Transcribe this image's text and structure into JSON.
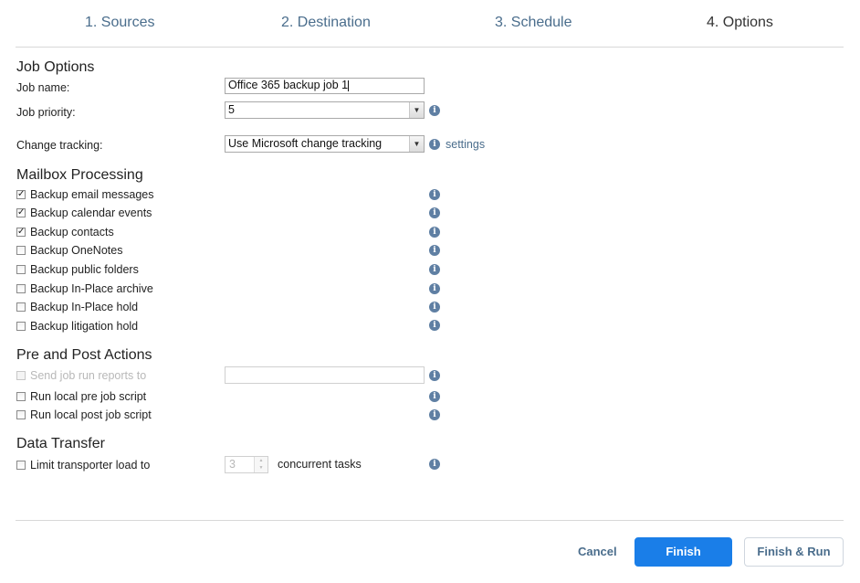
{
  "wizard": {
    "steps": [
      "1. Sources",
      "2. Destination",
      "3. Schedule",
      "4. Options"
    ],
    "active_step": 3
  },
  "job_options": {
    "title": "Job Options",
    "job_name_label": "Job name:",
    "job_name_value": "Office 365 backup job 1",
    "priority_label": "Job priority:",
    "priority_value": "5",
    "change_tracking_label": "Change tracking:",
    "change_tracking_value": "Use Microsoft change tracking",
    "settings_link": "settings"
  },
  "mailbox": {
    "title": "Mailbox Processing",
    "items": [
      {
        "label": "Backup email messages",
        "checked": true
      },
      {
        "label": "Backup calendar events",
        "checked": true
      },
      {
        "label": "Backup contacts",
        "checked": true
      },
      {
        "label": "Backup OneNotes",
        "checked": false
      },
      {
        "label": "Backup public folders",
        "checked": false
      },
      {
        "label": "Backup In-Place archive",
        "checked": false
      },
      {
        "label": "Backup In-Place hold",
        "checked": false
      },
      {
        "label": "Backup litigation hold",
        "checked": false
      }
    ]
  },
  "pre_post": {
    "title": "Pre and Post Actions",
    "send_reports_label": "Send job run reports to",
    "send_reports_value": "",
    "pre_script_label": "Run local pre job script",
    "post_script_label": "Run local post job script"
  },
  "data_transfer": {
    "title": "Data Transfer",
    "limit_label": "Limit transporter load to",
    "limit_value": "3",
    "concurrent_label": "concurrent tasks"
  },
  "footer": {
    "cancel": "Cancel",
    "finish": "Finish",
    "finish_run": "Finish & Run"
  },
  "colors": {
    "accent": "#1a7ee8",
    "link": "#4a6d8c",
    "info_icon": "#5f7fa3"
  }
}
